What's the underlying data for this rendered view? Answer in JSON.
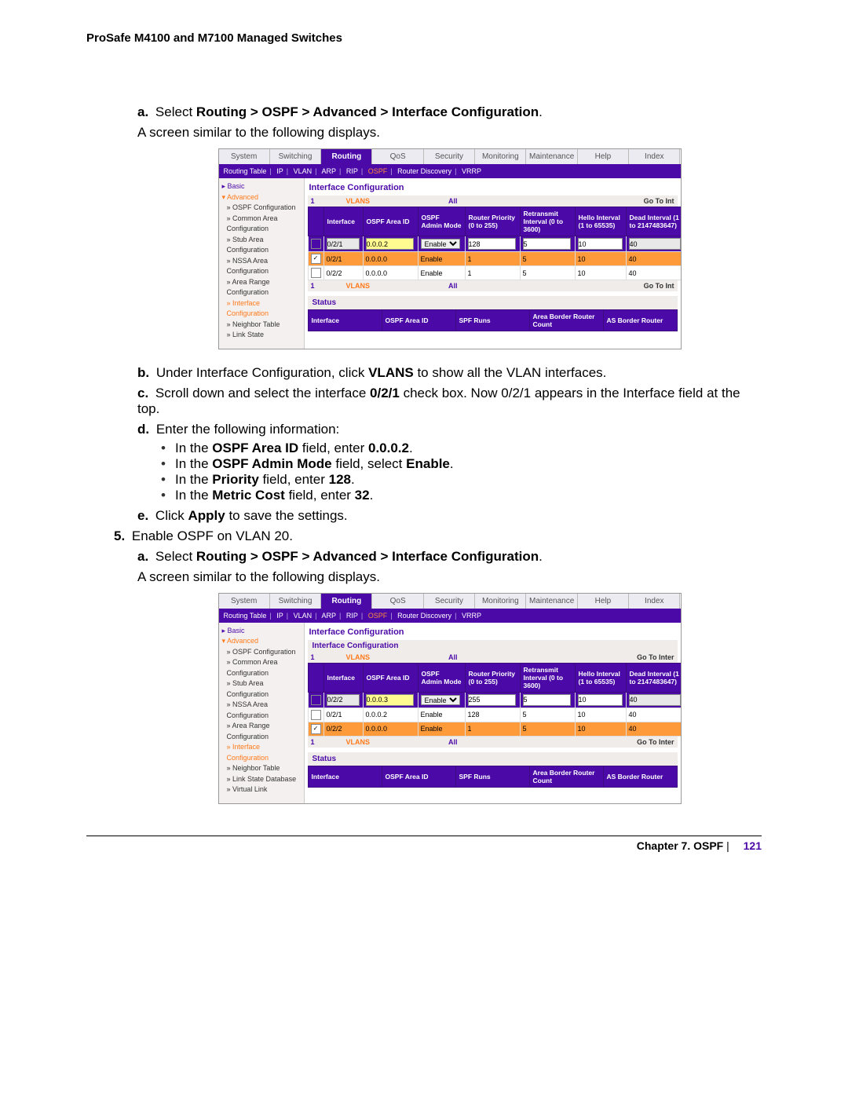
{
  "header": "ProSafe M4100 and M7100 Managed Switches",
  "step_a1_label": "a.",
  "step_a1_prefix": "Select ",
  "step_a1_bold": "Routing > OSPF > Advanced > Interface Configuration",
  "step_a1_suffix": ".",
  "line_screen": "A screen similar to the following displays.",
  "step_b_label": "b.",
  "step_b_pre": "Under Interface Configuration, click ",
  "step_b_bold": "VLANS",
  "step_b_post": " to show all the VLAN interfaces.",
  "step_c_label": "c.",
  "step_c_pre": "Scroll down and select the interface ",
  "step_c_bold": "0/2/1",
  "step_c_post": " check box. Now 0/2/1 appears in the Interface field at the top.",
  "step_d_label": "d.",
  "step_d_text": "Enter the following information:",
  "bullet1_pre": "In the ",
  "bullet1_b1": "OSPF Area ID",
  "bullet1_mid": " field, enter ",
  "bullet1_b2": "0.0.0.2",
  "bullet1_post": ".",
  "bullet2_pre": "In the ",
  "bullet2_b1": "OSPF Admin Mode",
  "bullet2_mid": " field, select ",
  "bullet2_b2": "Enable",
  "bullet2_post": ".",
  "bullet3_pre": "In the ",
  "bullet3_b1": "Priority",
  "bullet3_mid": " field, enter ",
  "bullet3_b2": "128",
  "bullet3_post": ".",
  "bullet4_pre": "In the ",
  "bullet4_b1": "Metric Cost",
  "bullet4_mid": " field, enter ",
  "bullet4_b2": "32",
  "bullet4_post": ".",
  "step_e_label": "e.",
  "step_e_pre": "Click ",
  "step_e_bold": "Apply",
  "step_e_post": " to save the settings.",
  "step5_label": "5.",
  "step5_text": "Enable OSPF on VLAN 20.",
  "step_a2_label": "a.",
  "step_a2_prefix": "Select ",
  "step_a2_bold": "Routing > OSPF > Advanced > Interface Configuration",
  "step_a2_suffix": ".",
  "footer_chapter": "Chapter 7.  OSPF",
  "footer_sep": " |",
  "footer_page": "121",
  "ui_tabs": [
    "System",
    "Switching",
    "Routing",
    "QoS",
    "Security",
    "Monitoring",
    "Maintenance",
    "Help",
    "Index"
  ],
  "ui_subnav": [
    "Routing Table",
    "IP",
    "VLAN",
    "ARP",
    "RIP",
    "OSPF",
    "Router Discovery",
    "VRRP"
  ],
  "ui_side": {
    "basic": "Basic",
    "advanced": "Advanced",
    "items": [
      "OSPF Configuration",
      "Common Area Configuration",
      "Stub Area Configuration",
      "NSSA Area Configuration",
      "Area Range Configuration",
      "Interface Configuration",
      "Neighbor Table",
      "Link State"
    ],
    "items2_extra": [
      "Link State Database",
      "Virtual Link"
    ]
  },
  "panel_title": "Interface Configuration",
  "panel_sub": "Interface Configuration",
  "banner": {
    "one": "1",
    "vlans": "VLANS",
    "all": "All",
    "goto1": "Go To Int",
    "goto2": "Go To Inter"
  },
  "th": {
    "iface": "Interface",
    "area": "OSPF Area ID",
    "admin": "OSPF Admin Mode",
    "prio": "Router Priority (0 to 255)",
    "retr": "Retransmit Interval (0 to 3600)",
    "hello": "Hello Interval (1 to 65535)",
    "dead": "Dead Interval (1 to 2147483647)"
  },
  "ui1_rows": {
    "input": {
      "iface": "0/2/1",
      "area": "0.0.0.2",
      "admin": "Enable",
      "prio": "128",
      "retr": "5",
      "hello": "10",
      "dead": "40"
    },
    "orange": {
      "iface": "0/2/1",
      "area": "0.0.0.0",
      "admin": "Enable",
      "prio": "1",
      "retr": "5",
      "hello": "10",
      "dead": "40"
    },
    "plain": {
      "iface": "0/2/2",
      "area": "0.0.0.0",
      "admin": "Enable",
      "prio": "1",
      "retr": "5",
      "hello": "10",
      "dead": "40"
    }
  },
  "ui2_rows": {
    "input": {
      "iface": "0/2/2",
      "area": "0.0.0.3",
      "admin": "Enable",
      "prio": "255",
      "retr": "5",
      "hello": "10",
      "dead": "40"
    },
    "plain": {
      "iface": "0/2/1",
      "area": "0.0.0.2",
      "admin": "Enable",
      "prio": "128",
      "retr": "5",
      "hello": "10",
      "dead": "40"
    },
    "orange": {
      "iface": "0/2/2",
      "area": "0.0.0.0",
      "admin": "Enable",
      "prio": "1",
      "retr": "5",
      "hello": "10",
      "dead": "40"
    }
  },
  "status_title": "Status",
  "status_th": {
    "iface": "Interface",
    "area": "OSPF Area ID",
    "spf": "SPF Runs",
    "abrc": "Area Border Router Count",
    "asbr": "AS Border Router"
  }
}
